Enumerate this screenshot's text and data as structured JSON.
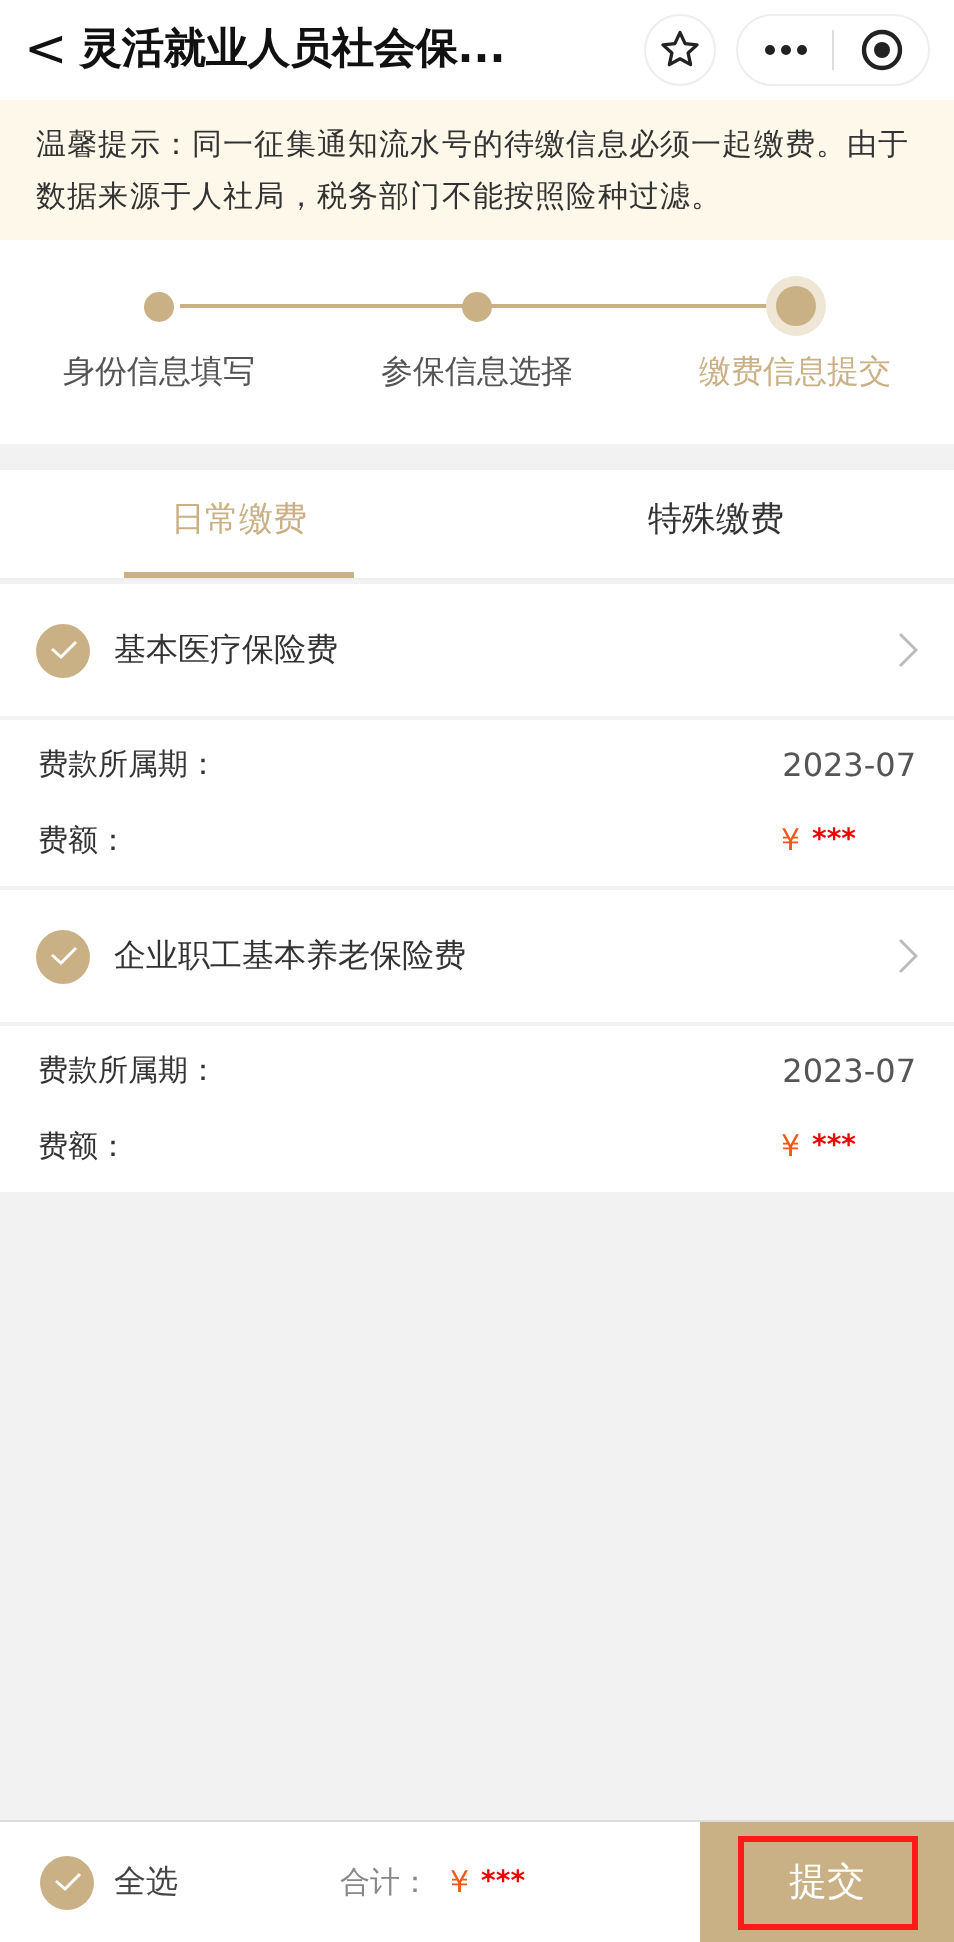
{
  "header": {
    "back": "<",
    "title": "灵活就业人员社会保..."
  },
  "notice": "温馨提示：同一征集通知流水号的待缴信息必须一起缴费。由于数据来源于人社局，税务部门不能按照险种过滤。",
  "steps": [
    {
      "label": "身份信息填写",
      "selected": false
    },
    {
      "label": "参保信息选择",
      "selected": false
    },
    {
      "label": "缴费信息提交",
      "selected": true
    }
  ],
  "tabs": [
    {
      "label": "日常缴费",
      "selected": true
    },
    {
      "label": "特殊缴费",
      "selected": false
    }
  ],
  "items": [
    {
      "name": "基本医疗保险费",
      "checked": true,
      "period_label": "费款所属期：",
      "period": "2023-07",
      "amount_label": "费额：",
      "currency": "¥",
      "amount": "***"
    },
    {
      "name": "企业职工基本养老保险费",
      "checked": true,
      "period_label": "费款所属期：",
      "period": "2023-07",
      "amount_label": "费额：",
      "currency": "¥",
      "amount": "***"
    }
  ],
  "footer": {
    "select_all": {
      "label": "全选",
      "checked": true
    },
    "total_label": "合计：",
    "currency": "¥",
    "total": "***",
    "submit": {
      "label": "提交",
      "highlighted": true
    }
  }
}
